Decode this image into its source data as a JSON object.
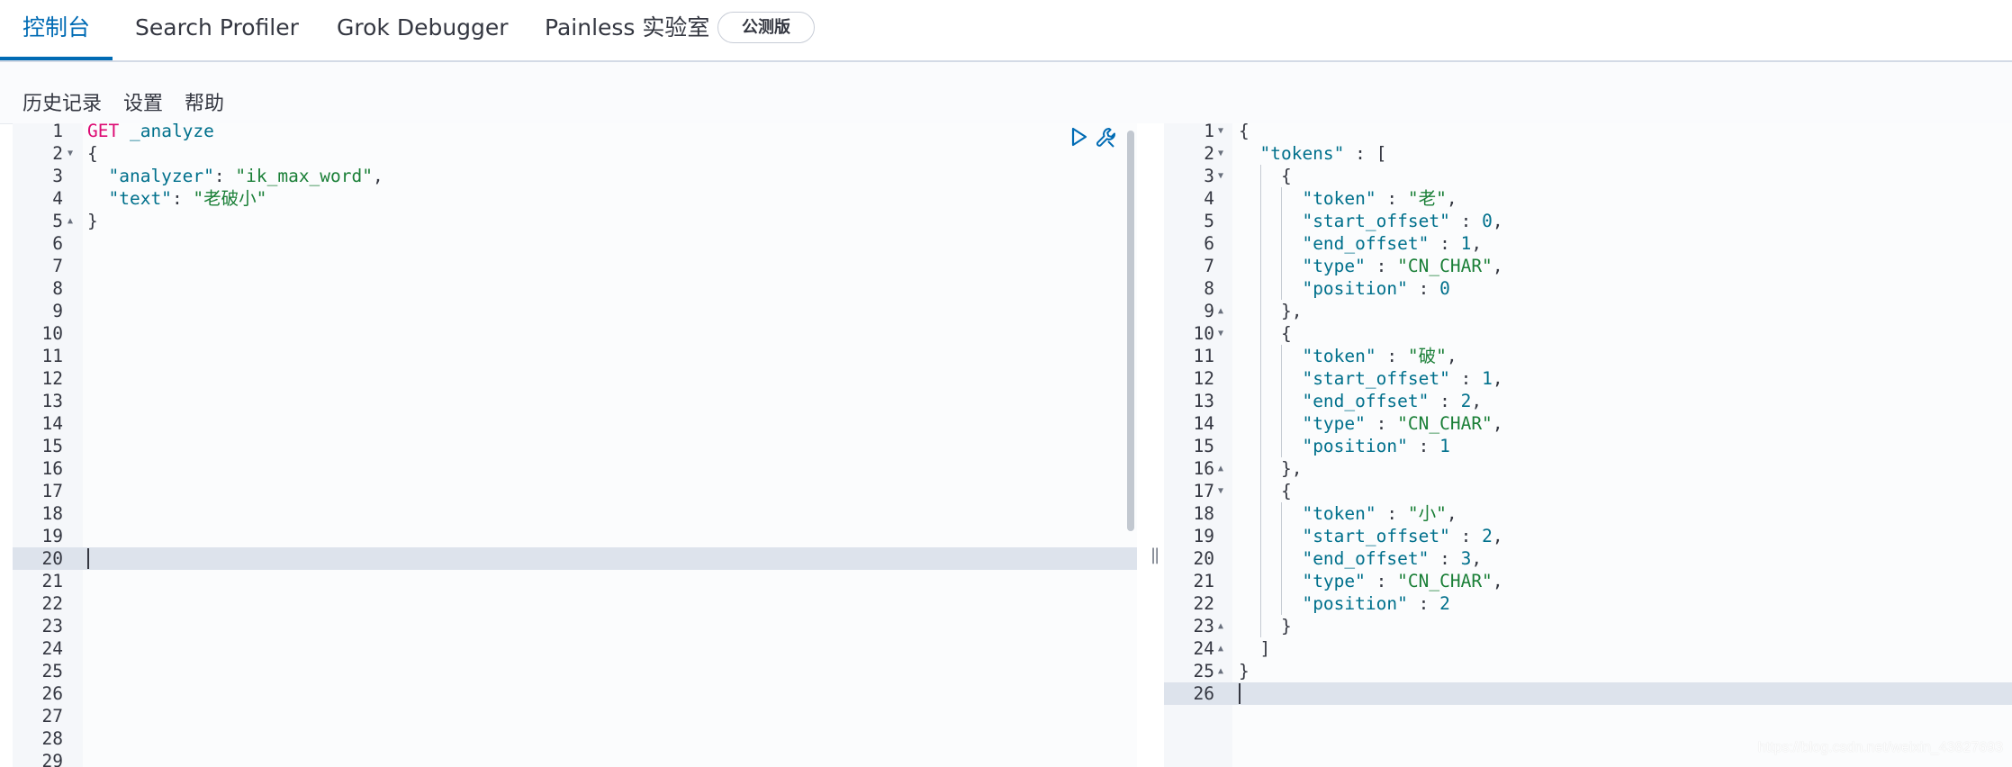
{
  "tabs": [
    {
      "label": "控制台",
      "active": true
    },
    {
      "label": "Search Profiler"
    },
    {
      "label": "Grok Debugger"
    },
    {
      "label": "Painless 实验室"
    }
  ],
  "beta_badge": "公测版",
  "toolbar": {
    "history": "历史记录",
    "settings": "设置",
    "help": "帮助"
  },
  "request_editor": {
    "active_line": 20,
    "line_count": 29,
    "code": [
      {
        "n": 1,
        "tokens": [
          [
            "method",
            "GET"
          ],
          [
            "punc",
            " "
          ],
          [
            "url",
            "_analyze"
          ]
        ]
      },
      {
        "n": 2,
        "fold": "open",
        "tokens": [
          [
            "punc",
            "{"
          ]
        ]
      },
      {
        "n": 3,
        "tokens": [
          [
            "punc",
            "  "
          ],
          [
            "key",
            "\"analyzer\""
          ],
          [
            "punc",
            ": "
          ],
          [
            "str",
            "\"ik_max_word\""
          ],
          [
            "punc",
            ","
          ]
        ]
      },
      {
        "n": 4,
        "tokens": [
          [
            "punc",
            "  "
          ],
          [
            "key",
            "\"text\""
          ],
          [
            "punc",
            ": "
          ],
          [
            "str",
            "\"老破小\""
          ]
        ]
      },
      {
        "n": 5,
        "fold": "close",
        "tokens": [
          [
            "punc",
            "}"
          ]
        ]
      }
    ]
  },
  "response_editor": {
    "active_line": 26,
    "line_count": 26,
    "code": [
      {
        "n": 1,
        "fold": "open",
        "tokens": [
          [
            "punc",
            "{"
          ]
        ]
      },
      {
        "n": 2,
        "fold": "open",
        "tokens": [
          [
            "punc",
            "  "
          ],
          [
            "key",
            "\"tokens\""
          ],
          [
            "punc",
            " : ["
          ]
        ]
      },
      {
        "n": 3,
        "fold": "open",
        "tokens": [
          [
            "punc",
            "    {"
          ]
        ]
      },
      {
        "n": 4,
        "tokens": [
          [
            "punc",
            "      "
          ],
          [
            "key",
            "\"token\""
          ],
          [
            "punc",
            " : "
          ],
          [
            "str",
            "\"老\""
          ],
          [
            "punc",
            ","
          ]
        ]
      },
      {
        "n": 5,
        "tokens": [
          [
            "punc",
            "      "
          ],
          [
            "key",
            "\"start_offset\""
          ],
          [
            "punc",
            " : "
          ],
          [
            "num",
            "0"
          ],
          [
            "punc",
            ","
          ]
        ]
      },
      {
        "n": 6,
        "tokens": [
          [
            "punc",
            "      "
          ],
          [
            "key",
            "\"end_offset\""
          ],
          [
            "punc",
            " : "
          ],
          [
            "num",
            "1"
          ],
          [
            "punc",
            ","
          ]
        ]
      },
      {
        "n": 7,
        "tokens": [
          [
            "punc",
            "      "
          ],
          [
            "key",
            "\"type\""
          ],
          [
            "punc",
            " : "
          ],
          [
            "str",
            "\"CN_CHAR\""
          ],
          [
            "punc",
            ","
          ]
        ]
      },
      {
        "n": 8,
        "tokens": [
          [
            "punc",
            "      "
          ],
          [
            "key",
            "\"position\""
          ],
          [
            "punc",
            " : "
          ],
          [
            "num",
            "0"
          ]
        ]
      },
      {
        "n": 9,
        "fold": "close",
        "tokens": [
          [
            "punc",
            "    },"
          ]
        ]
      },
      {
        "n": 10,
        "fold": "open",
        "tokens": [
          [
            "punc",
            "    {"
          ]
        ]
      },
      {
        "n": 11,
        "tokens": [
          [
            "punc",
            "      "
          ],
          [
            "key",
            "\"token\""
          ],
          [
            "punc",
            " : "
          ],
          [
            "str",
            "\"破\""
          ],
          [
            "punc",
            ","
          ]
        ]
      },
      {
        "n": 12,
        "tokens": [
          [
            "punc",
            "      "
          ],
          [
            "key",
            "\"start_offset\""
          ],
          [
            "punc",
            " : "
          ],
          [
            "num",
            "1"
          ],
          [
            "punc",
            ","
          ]
        ]
      },
      {
        "n": 13,
        "tokens": [
          [
            "punc",
            "      "
          ],
          [
            "key",
            "\"end_offset\""
          ],
          [
            "punc",
            " : "
          ],
          [
            "num",
            "2"
          ],
          [
            "punc",
            ","
          ]
        ]
      },
      {
        "n": 14,
        "tokens": [
          [
            "punc",
            "      "
          ],
          [
            "key",
            "\"type\""
          ],
          [
            "punc",
            " : "
          ],
          [
            "str",
            "\"CN_CHAR\""
          ],
          [
            "punc",
            ","
          ]
        ]
      },
      {
        "n": 15,
        "tokens": [
          [
            "punc",
            "      "
          ],
          [
            "key",
            "\"position\""
          ],
          [
            "punc",
            " : "
          ],
          [
            "num",
            "1"
          ]
        ]
      },
      {
        "n": 16,
        "fold": "close",
        "tokens": [
          [
            "punc",
            "    },"
          ]
        ]
      },
      {
        "n": 17,
        "fold": "open",
        "tokens": [
          [
            "punc",
            "    {"
          ]
        ]
      },
      {
        "n": 18,
        "tokens": [
          [
            "punc",
            "      "
          ],
          [
            "key",
            "\"token\""
          ],
          [
            "punc",
            " : "
          ],
          [
            "str",
            "\"小\""
          ],
          [
            "punc",
            ","
          ]
        ]
      },
      {
        "n": 19,
        "tokens": [
          [
            "punc",
            "      "
          ],
          [
            "key",
            "\"start_offset\""
          ],
          [
            "punc",
            " : "
          ],
          [
            "num",
            "2"
          ],
          [
            "punc",
            ","
          ]
        ]
      },
      {
        "n": 20,
        "tokens": [
          [
            "punc",
            "      "
          ],
          [
            "key",
            "\"end_offset\""
          ],
          [
            "punc",
            " : "
          ],
          [
            "num",
            "3"
          ],
          [
            "punc",
            ","
          ]
        ]
      },
      {
        "n": 21,
        "tokens": [
          [
            "punc",
            "      "
          ],
          [
            "key",
            "\"type\""
          ],
          [
            "punc",
            " : "
          ],
          [
            "str",
            "\"CN_CHAR\""
          ],
          [
            "punc",
            ","
          ]
        ]
      },
      {
        "n": 22,
        "tokens": [
          [
            "punc",
            "      "
          ],
          [
            "key",
            "\"position\""
          ],
          [
            "punc",
            " : "
          ],
          [
            "num",
            "2"
          ]
        ]
      },
      {
        "n": 23,
        "fold": "close",
        "tokens": [
          [
            "punc",
            "    }"
          ]
        ]
      },
      {
        "n": 24,
        "fold": "close",
        "tokens": [
          [
            "punc",
            "  ]"
          ]
        ]
      },
      {
        "n": 25,
        "fold": "close",
        "tokens": [
          [
            "punc",
            "}"
          ]
        ]
      }
    ]
  },
  "icons": {
    "send": "play-icon",
    "settings": "wrench-icon",
    "resize": "resize-handle-icon"
  },
  "colors": {
    "accent": "#006bb4",
    "method": "#dd0a73",
    "key": "#00708c",
    "string": "#1a7f37",
    "active_line": "#dde3ec"
  },
  "watermark": "https://blog.csdn.net/weixin_43827693"
}
